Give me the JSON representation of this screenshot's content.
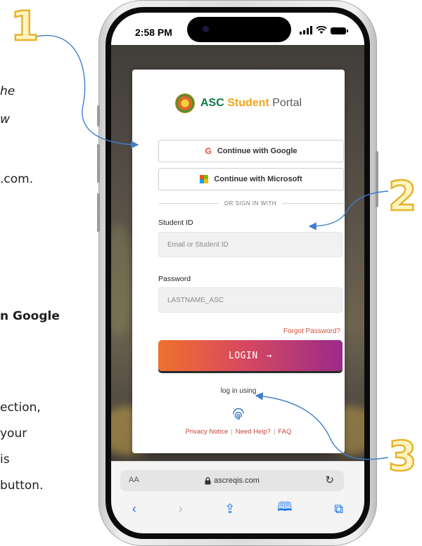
{
  "doc_fragments": {
    "line1": "he",
    "line2": "w",
    "link": ".com",
    "period": ".",
    "bold": "n Google",
    "line3": "ection,",
    "line4": " your",
    "line5": "is",
    "line6": "button."
  },
  "callouts": [
    "1",
    "2",
    "3"
  ],
  "status_bar": {
    "time": "2:58 PM"
  },
  "brand": {
    "acronym": "ASC",
    "student": "Student",
    "portal": "Portal"
  },
  "sso": {
    "google_label": "Continue with Google",
    "microsoft_label": "Continue with Microsoft"
  },
  "divider": "OR SIGN IN WITH",
  "student_id": {
    "label": "Student ID",
    "placeholder": "Email or Student ID"
  },
  "password": {
    "label": "Password",
    "value": "LASTNAME_ASC"
  },
  "forgot_password": "Forgot Password?",
  "login_button": {
    "label": "LOGIN",
    "arrow": "→"
  },
  "login_using": "log in using",
  "links": {
    "privacy": "Privacy Notice",
    "help": "Need Help?",
    "faq": "FAQ"
  },
  "safari": {
    "aa": "AA",
    "url": "ascreqis.com"
  },
  "colors": {
    "accent_green": "#0e7a44",
    "accent_gold": "#f2a51a",
    "link_red": "#c4453a",
    "callout_gold": "#e8b32a"
  }
}
